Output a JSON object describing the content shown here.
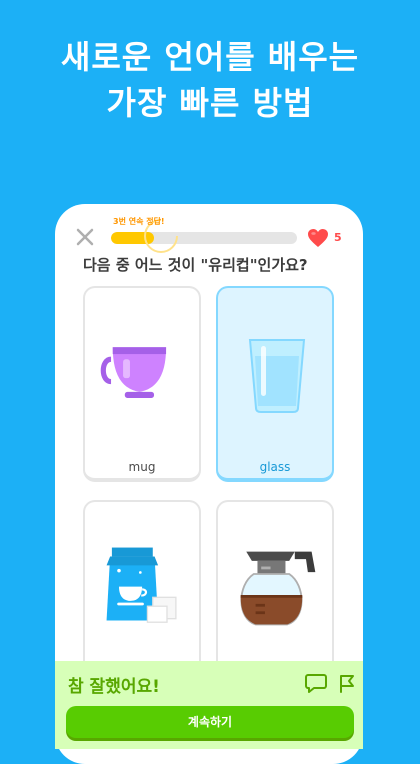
{
  "hero": {
    "line1": "새로운 언어를 배우는",
    "line2": "가장 빠른 방법"
  },
  "lesson": {
    "streak_label": "3번 연속 정답!",
    "progress": 0.23,
    "hearts": "5",
    "question": "다음 중 어느 것이 \"유리컵\"인가요?",
    "options": [
      {
        "label": "mug",
        "icon": "mug-icon",
        "selected": false
      },
      {
        "label": "glass",
        "icon": "glass-icon",
        "selected": true
      },
      {
        "label": "",
        "icon": "sugar-bag-icon",
        "selected": false
      },
      {
        "label": "",
        "icon": "coffee-pot-icon",
        "selected": false
      }
    ]
  },
  "feedback": {
    "title": "참 잘했어요!",
    "continue_label": "계속하기",
    "icons": [
      "comment-icon",
      "flag-icon"
    ]
  },
  "colors": {
    "background": "#1cb0f6",
    "progress": "#ffc800",
    "success": "#58cc02",
    "heart": "#ff4b4b",
    "selected_border": "#84d8ff"
  }
}
